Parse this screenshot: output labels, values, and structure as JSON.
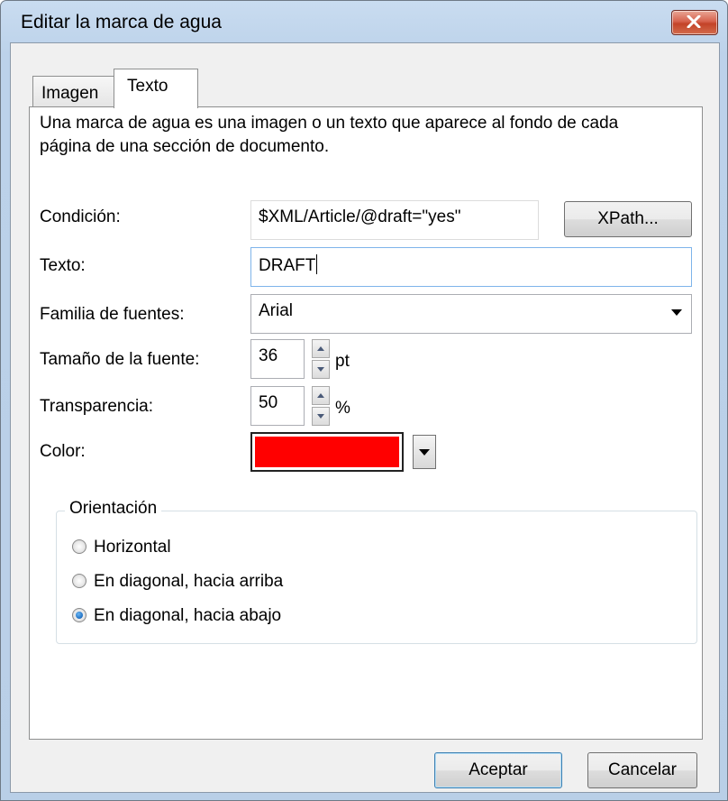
{
  "window": {
    "title": "Editar la marca de agua"
  },
  "tabs": [
    {
      "label": "Imagen",
      "active": false
    },
    {
      "label": "Texto",
      "active": true
    }
  ],
  "description": "Una marca de agua es una imagen o un texto que aparece al fondo de cada página de una sección de documento.",
  "form": {
    "condition": {
      "label": "Condición:",
      "value": "$XML/Article/@draft=\"yes\"",
      "button": "XPath..."
    },
    "text": {
      "label": "Texto:",
      "value": "DRAFT"
    },
    "font_family": {
      "label": "Familia de fuentes:",
      "value": "Arial"
    },
    "font_size": {
      "label": "Tamaño de la fuente:",
      "value": "36",
      "unit": "pt"
    },
    "transparency": {
      "label": "Transparencia:",
      "value": "50",
      "unit": "%"
    },
    "color": {
      "label": "Color:",
      "value": "#ff0000"
    }
  },
  "orientation": {
    "title": "Orientación",
    "options": [
      {
        "label": "Horizontal",
        "selected": false
      },
      {
        "label": "En diagonal, hacia arriba",
        "selected": false
      },
      {
        "label": "En diagonal, hacia abajo",
        "selected": true
      }
    ]
  },
  "buttons": {
    "ok": "Aceptar",
    "cancel": "Cancelar"
  }
}
